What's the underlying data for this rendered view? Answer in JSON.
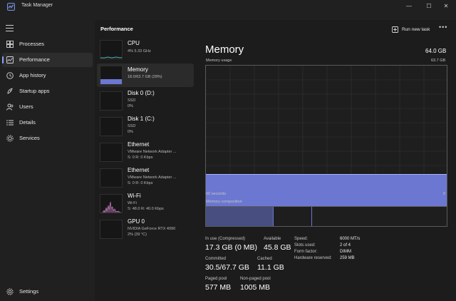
{
  "window": {
    "title": "Task Manager",
    "minimize_glyph": "—",
    "maximize_glyph": "☐",
    "close_glyph": "✕"
  },
  "colors": {
    "accent": "#8aa4ff",
    "memory_fill": "#6b77d1",
    "wifi_graph": "#c07ab8",
    "cpu_graph": "#4fb5b5"
  },
  "nav": {
    "menu_icon": "hamburger-icon",
    "items": [
      {
        "label": "Processes",
        "icon": "processes-icon"
      },
      {
        "label": "Performance",
        "icon": "performance-icon",
        "active": true
      },
      {
        "label": "App history",
        "icon": "app-history-icon"
      },
      {
        "label": "Startup apps",
        "icon": "startup-apps-icon"
      },
      {
        "label": "Users",
        "icon": "users-icon"
      },
      {
        "label": "Details",
        "icon": "details-icon"
      },
      {
        "label": "Services",
        "icon": "services-icon"
      }
    ],
    "settings": {
      "label": "Settings",
      "icon": "settings-icon"
    }
  },
  "header": {
    "title": "Performance",
    "run_task_label": "Run new task",
    "more_glyph": "•••"
  },
  "devices": [
    {
      "name": "CPU",
      "lines": [
        "4%  5.33 GHz"
      ]
    },
    {
      "name": "Memory",
      "lines": [
        "18.0/63.7 GB (28%)"
      ],
      "active": true
    },
    {
      "name": "Disk 0 (D:)",
      "lines": [
        "SSD",
        "0%"
      ]
    },
    {
      "name": "Disk 1 (C:)",
      "lines": [
        "SSD",
        "0%"
      ]
    },
    {
      "name": "Ethernet",
      "lines": [
        "VMware Network Adapter ...",
        "S: 0  R: 0 Kbps"
      ]
    },
    {
      "name": "Ethernet",
      "lines": [
        "VMware Network Adapter ...",
        "S: 0  R: 0 Kbps"
      ]
    },
    {
      "name": "Wi-Fi",
      "lines": [
        "Wi-Fi",
        "S: 48.0  R: 40.0 Kbps"
      ]
    },
    {
      "name": "GPU 0",
      "lines": [
        "NVIDIA GeForce RTX 4090",
        "2%  (39 °C)"
      ]
    }
  ],
  "memory": {
    "title": "Memory",
    "total": "64.0 GB",
    "usage_label": "Memory usage",
    "usage_max": "63.7 GB",
    "usage_fraction": 0.25,
    "time_left": "60 seconds",
    "time_right": "0",
    "composition_label": "Memory composition",
    "composition_fractions": [
      0.28,
      0.16,
      0.56
    ],
    "stats": {
      "in_use_label": "In use (Compressed)",
      "in_use_value": "17.3 GB (0 MB)",
      "available_label": "Available",
      "available_value": "45.8 GB",
      "committed_label": "Committed",
      "committed_value": "30.5/67.7 GB",
      "cached_label": "Cached",
      "cached_value": "11.1 GB",
      "paged_label": "Paged pool",
      "paged_value": "577 MB",
      "nonpaged_label": "Non-paged pool",
      "nonpaged_value": "1005 MB"
    },
    "specs": [
      {
        "label": "Speed:",
        "value": "6000 MT/s"
      },
      {
        "label": "Slots used:",
        "value": "2 of 4"
      },
      {
        "label": "Form factor:",
        "value": "DIMM"
      },
      {
        "label": "Hardware reserved:",
        "value": "259 MB"
      }
    ]
  }
}
